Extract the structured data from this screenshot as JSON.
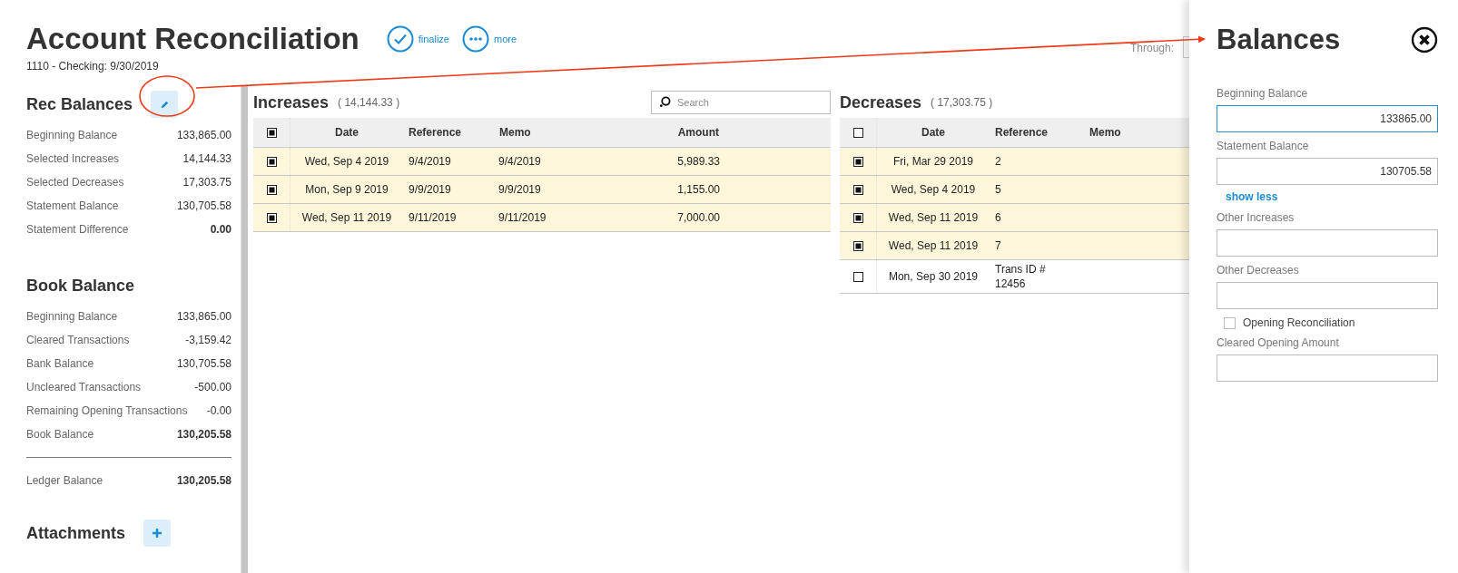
{
  "header": {
    "title": "Account Reconciliation",
    "subtitle": "1110 - Checking: 9/30/2019",
    "actions": [
      {
        "kind": "check",
        "label": "finalize"
      },
      {
        "kind": "dots",
        "label": "more"
      }
    ],
    "through_label": "Through:"
  },
  "rec_balances": {
    "title": "Rec Balances",
    "rows": [
      {
        "label": "Beginning Balance",
        "value": "133,865.00",
        "bold": false
      },
      {
        "label": "Selected Increases",
        "value": "14,144.33",
        "bold": false
      },
      {
        "label": "Selected Decreases",
        "value": "17,303.75",
        "bold": false
      },
      {
        "label": "Statement Balance",
        "value": "130,705.58",
        "bold": false
      },
      {
        "label": "Statement Difference",
        "value": "0.00",
        "bold": true
      }
    ]
  },
  "book_balance": {
    "title": "Book Balance",
    "rows": [
      {
        "label": "Beginning Balance",
        "value": "133,865.00",
        "bold": false
      },
      {
        "label": "Cleared Transactions",
        "value": "-3,159.42",
        "bold": false
      },
      {
        "label": "Bank Balance",
        "value": "130,705.58",
        "bold": false
      },
      {
        "label": "Uncleared Transactions",
        "value": "-500.00",
        "bold": false
      },
      {
        "label": "Remaining Opening Transactions",
        "value": "-0.00",
        "bold": false
      },
      {
        "label": "Book Balance",
        "value": "130,205.58",
        "bold": true
      }
    ],
    "ledger": {
      "label": "Ledger Balance",
      "value": "130,205.58",
      "bold": true
    }
  },
  "attachments": {
    "title": "Attachments"
  },
  "increases": {
    "title": "Increases",
    "total": "( 14,144.33 )",
    "search": {
      "placeholder": "Search"
    },
    "all_checked": true,
    "columns": [
      "Date",
      "Reference",
      "Memo",
      "Amount"
    ],
    "rows": [
      {
        "checked": true,
        "date": "Wed, Sep 4 2019",
        "reference": "9/4/2019",
        "memo": "9/4/2019",
        "amount": "5,989.33"
      },
      {
        "checked": true,
        "date": "Mon, Sep 9 2019",
        "reference": "9/9/2019",
        "memo": "9/9/2019",
        "amount": "1,155.00"
      },
      {
        "checked": true,
        "date": "Wed, Sep 11 2019",
        "reference": "9/11/2019",
        "memo": "9/11/2019",
        "amount": "7,000.00"
      }
    ]
  },
  "decreases": {
    "title": "Decreases",
    "total": "( 17,303.75 )",
    "all_checked": false,
    "columns": [
      "Date",
      "Reference",
      "Memo"
    ],
    "rows": [
      {
        "checked": true,
        "date": "Fri, Mar 29 2019",
        "reference": "2"
      },
      {
        "checked": true,
        "date": "Wed, Sep 4 2019",
        "reference": "5"
      },
      {
        "checked": true,
        "date": "Wed, Sep 11 2019",
        "reference": "6"
      },
      {
        "checked": true,
        "date": "Wed, Sep 11 2019",
        "reference": "7"
      },
      {
        "checked": false,
        "date": "Mon, Sep 30 2019",
        "reference": "Trans ID # 12456"
      }
    ]
  },
  "drawer": {
    "title": "Balances",
    "fields": [
      {
        "kind": "input",
        "label": "Beginning Balance",
        "value": "133865.00",
        "focused": true
      },
      {
        "kind": "input",
        "label": "Statement Balance",
        "value": "130705.58",
        "focused": false
      },
      {
        "kind": "link",
        "label": "show less"
      },
      {
        "kind": "input",
        "label": "Other Increases",
        "focused": false
      },
      {
        "kind": "input",
        "label": "Other Decreases",
        "focused": false
      },
      {
        "kind": "checkbox",
        "label": "Opening Reconciliation",
        "checked": false
      },
      {
        "kind": "input",
        "label": "Cleared Opening Amount",
        "focused": false
      }
    ]
  }
}
